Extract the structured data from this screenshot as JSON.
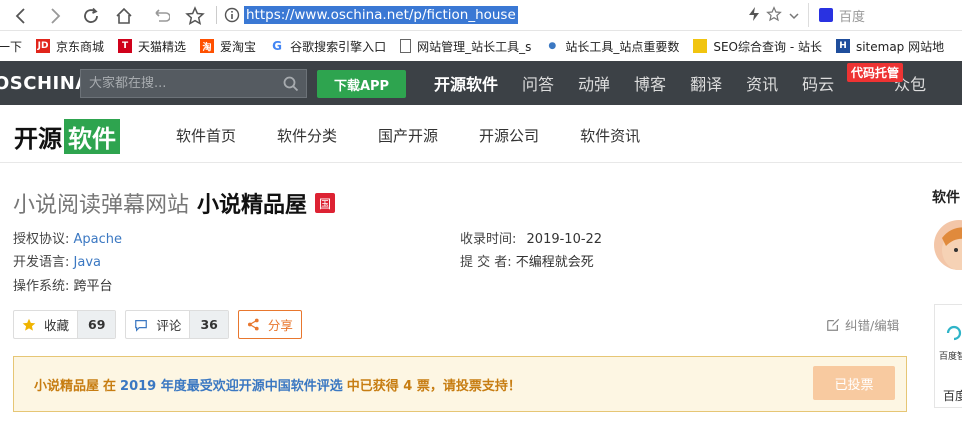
{
  "browser": {
    "url": "https://www.oschina.net/p/fiction_house",
    "search_engine": "百度"
  },
  "bookmarks": [
    {
      "label": "一下",
      "icon": ""
    },
    {
      "label": "京东商城",
      "icon": "jd-icon"
    },
    {
      "label": "天猫精选",
      "icon": "tmall-icon"
    },
    {
      "label": "爱淘宝",
      "icon": "taobao-icon"
    },
    {
      "label": "谷歌搜索引擎入口",
      "icon": "google-icon"
    },
    {
      "label": "网站管理_站长工具_s",
      "icon": "doc-icon"
    },
    {
      "label": "站长工具_站点重要数",
      "icon": "paw-icon"
    },
    {
      "label": "SEO综合查询 - 站长",
      "icon": "seo-icon"
    },
    {
      "label": "sitemap 网站地",
      "icon": "sitemap-icon"
    }
  ],
  "site": {
    "logo": "OSCHINA",
    "search_placeholder": "大家都在搜...",
    "download_app": "下载APP",
    "nav": [
      "开源软件",
      "问答",
      "动弹",
      "博客",
      "翻译",
      "资讯",
      "码云",
      "众包"
    ],
    "nav_hot_tag": "代码托管"
  },
  "subnav": {
    "brand_a": "开源",
    "brand_b": "软件",
    "links": [
      "软件首页",
      "软件分类",
      "国产开源",
      "开源公司",
      "软件资讯"
    ]
  },
  "project": {
    "desc": "小说阅读弹幕网站",
    "name": "小说精品屋",
    "badge": "国",
    "license_label": "授权协议:",
    "license": "Apache",
    "language_label": "开发语言:",
    "language": "Java",
    "os_label": "操作系统:",
    "os": "跨平台",
    "time_label": "收录时间:",
    "time": "2019-10-22",
    "submitter_label": "提 交 者:",
    "submitter": "不编程就会死"
  },
  "actions": {
    "favorite_label": "收藏",
    "favorite_count": "69",
    "comment_label": "评论",
    "comment_count": "36",
    "share_label": "分享",
    "edit_label": "纠错/编辑"
  },
  "vote": {
    "name": "小说精品屋",
    "pre": "在",
    "year_text": "2019 年度最受欢迎开源中国软件评选",
    "post": "中已获得 4 票，请投票支持！",
    "button": "已投票"
  },
  "sidebar": {
    "title": "软件",
    "card_label": "百度智",
    "card_bottom": "百度"
  }
}
